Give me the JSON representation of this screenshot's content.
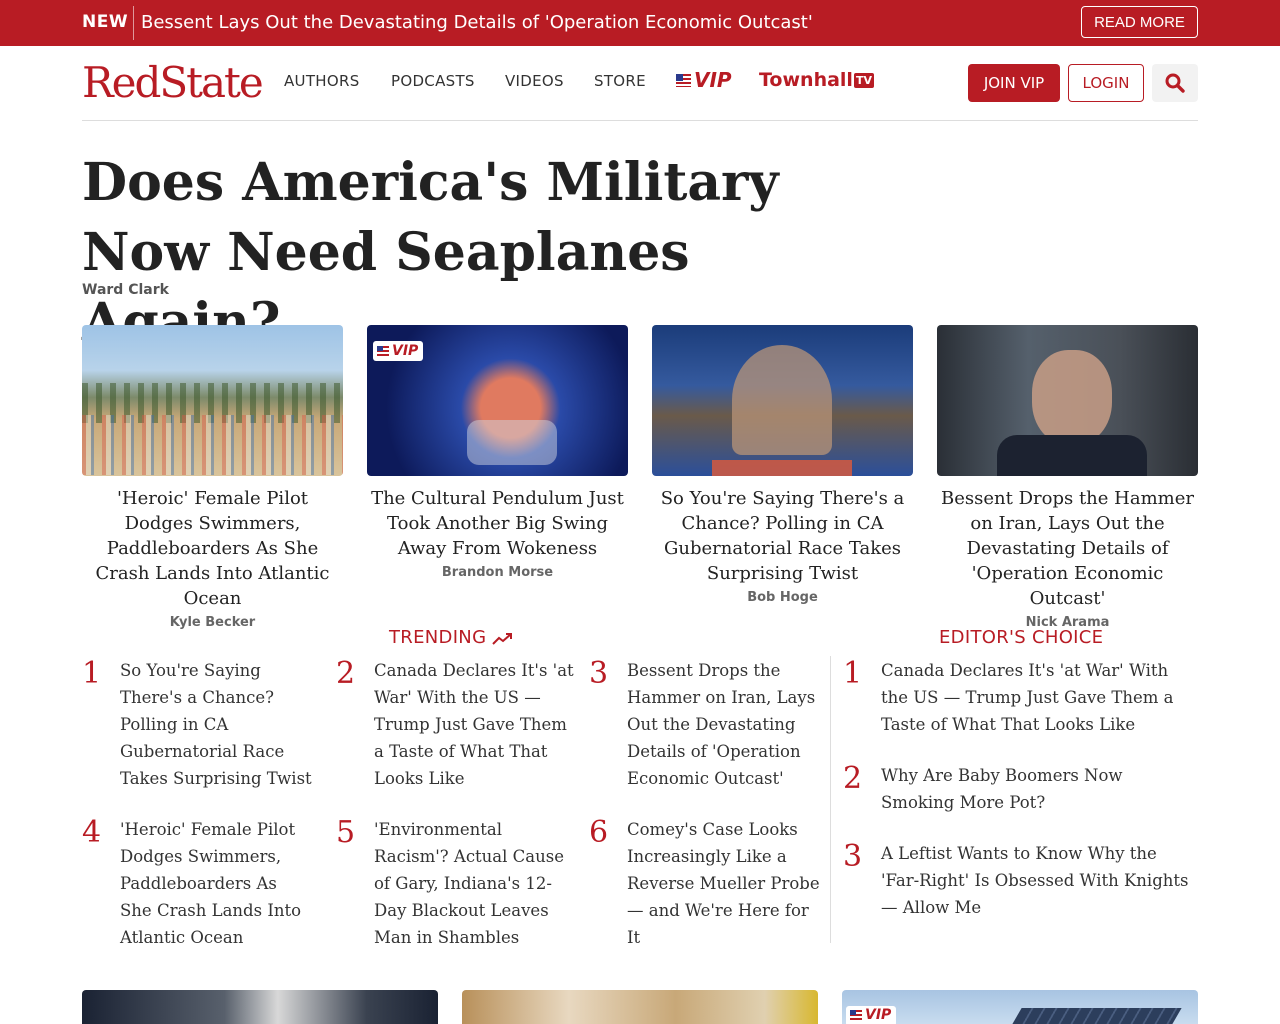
{
  "banner": {
    "label": "NEW",
    "headline": "Bessent Lays Out the Devastating Details of 'Operation Economic Outcast'",
    "read_more": "READ MORE"
  },
  "nav": {
    "logo": "RedState",
    "links": [
      "AUTHORS",
      "PODCASTS",
      "VIDEOS",
      "STORE"
    ],
    "vip": "VIP",
    "townhall": "Townhall",
    "townhall_tv": "TV",
    "join": "JOIN VIP",
    "login": "LOGIN"
  },
  "hero": {
    "title": "Does America's Military Now Need Seaplanes Again?",
    "author": "Ward Clark"
  },
  "cards": [
    {
      "title": "'Heroic' Female Pilot Dodges Swimmers, Paddleboarders As She Crash Lands Into Atlantic Ocean",
      "author": "Kyle Becker"
    },
    {
      "title": "The Cultural Pendulum Just Took Another Big Swing Away From Wokeness",
      "author": "Brandon Morse",
      "badge": "VIP"
    },
    {
      "title": "So You're Saying There's a Chance? Polling in CA Gubernatorial Race Takes Surprising Twist",
      "author": "Bob Hoge"
    },
    {
      "title": "Bessent Drops the Hammer on Iran, Lays Out the Devastating Details of 'Operation Economic Outcast'",
      "author": "Nick Arama"
    }
  ],
  "trending": {
    "heading": "TRENDING",
    "items": [
      {
        "num": "1",
        "text": "So You're Saying There's a Chance? Polling in CA Gubernatorial Race Takes Surprising Twist"
      },
      {
        "num": "2",
        "text": "Canada Declares It's 'at War' With the US — Trump Just Gave Them a Taste of What That Looks Like"
      },
      {
        "num": "3",
        "text": "Bessent Drops the Hammer on Iran, Lays Out the Devastating Details of 'Operation Economic Outcast'"
      },
      {
        "num": "4",
        "text": "'Heroic' Female Pilot Dodges Swimmers, Paddleboarders As She Crash Lands Into Atlantic Ocean"
      },
      {
        "num": "5",
        "text": "'Environmental Racism'? Actual Cause of Gary, Indiana's 12-Day Blackout Leaves Man in Shambles"
      },
      {
        "num": "6",
        "text": "Comey's Case Looks Increasingly Like a Reverse Mueller Probe — and We're Here for It"
      }
    ]
  },
  "editors": {
    "heading": "EDITOR'S CHOICE",
    "items": [
      {
        "num": "1",
        "text": "Canada Declares It's 'at War' With the US — Trump Just Gave Them a Taste of What That Looks Like"
      },
      {
        "num": "2",
        "text": "Why Are Baby Boomers Now Smoking More Pot?"
      },
      {
        "num": "3",
        "text": "A Leftist Wants to Know Why the 'Far-Right' Is Obsessed With Knights — Allow Me"
      }
    ]
  },
  "bottom": {
    "badge": "VIP"
  },
  "colors": {
    "brand": "#b81c24"
  }
}
